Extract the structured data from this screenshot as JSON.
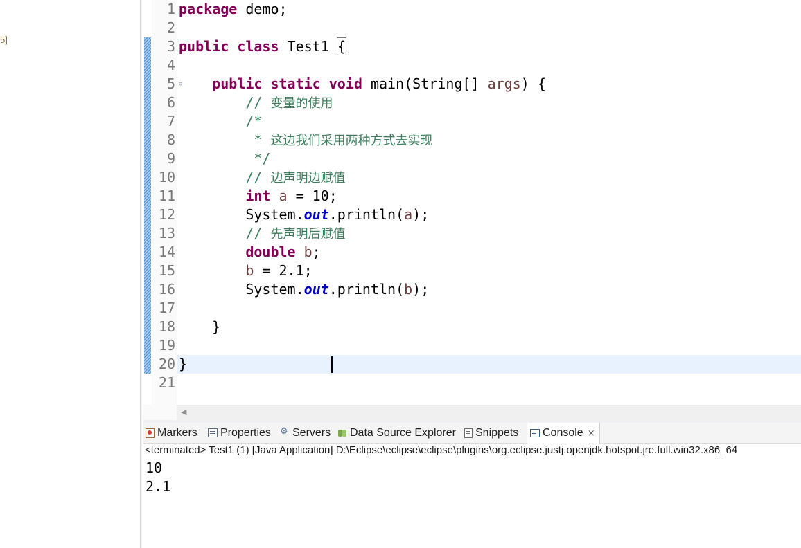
{
  "left_pane": {
    "fragment": "5]"
  },
  "editor": {
    "line_numbers": [
      "1",
      "2",
      "3",
      "4",
      "5",
      "6",
      "7",
      "8",
      "9",
      "10",
      "11",
      "12",
      "13",
      "14",
      "15",
      "16",
      "17",
      "18",
      "19",
      "20",
      "21"
    ],
    "lines": [
      [
        {
          "t": "package",
          "c": "kw"
        },
        {
          "t": " demo;"
        }
      ],
      [],
      [
        {
          "t": "public",
          "c": "kw"
        },
        {
          "t": " "
        },
        {
          "t": "class",
          "c": "kw"
        },
        {
          "t": " Test1 "
        },
        {
          "t": "{",
          "c": "brace-box"
        }
      ],
      [],
      [
        {
          "t": "    "
        },
        {
          "t": "public",
          "c": "kw"
        },
        {
          "t": " "
        },
        {
          "t": "static",
          "c": "kw"
        },
        {
          "t": " "
        },
        {
          "t": "void",
          "c": "kw"
        },
        {
          "t": " main(String[] "
        },
        {
          "t": "args",
          "c": "var"
        },
        {
          "t": ") {"
        }
      ],
      [
        {
          "t": "        "
        },
        {
          "t": "// ",
          "c": "cm"
        },
        {
          "t": "变量的使用",
          "c": "cmcn"
        }
      ],
      [
        {
          "t": "        "
        },
        {
          "t": "/*",
          "c": "cm"
        }
      ],
      [
        {
          "t": "         "
        },
        {
          "t": "* ",
          "c": "cm"
        },
        {
          "t": "这边我们采用两种方式去实现",
          "c": "cmcn"
        }
      ],
      [
        {
          "t": "         "
        },
        {
          "t": "*/",
          "c": "cm"
        }
      ],
      [
        {
          "t": "        "
        },
        {
          "t": "// ",
          "c": "cm"
        },
        {
          "t": "边声明边赋值",
          "c": "cmcn"
        }
      ],
      [
        {
          "t": "        "
        },
        {
          "t": "int",
          "c": "kw"
        },
        {
          "t": " "
        },
        {
          "t": "a",
          "c": "var"
        },
        {
          "t": " = 10;"
        }
      ],
      [
        {
          "t": "        System."
        },
        {
          "t": "out",
          "c": "fld"
        },
        {
          "t": ".println("
        },
        {
          "t": "a",
          "c": "var"
        },
        {
          "t": ");"
        }
      ],
      [
        {
          "t": "        "
        },
        {
          "t": "// ",
          "c": "cm"
        },
        {
          "t": "先声明后赋值",
          "c": "cmcn"
        }
      ],
      [
        {
          "t": "        "
        },
        {
          "t": "double",
          "c": "kw"
        },
        {
          "t": " "
        },
        {
          "t": "b",
          "c": "var"
        },
        {
          "t": ";"
        }
      ],
      [
        {
          "t": "        "
        },
        {
          "t": "b",
          "c": "var"
        },
        {
          "t": " = 2.1;"
        }
      ],
      [
        {
          "t": "        System."
        },
        {
          "t": "out",
          "c": "fld"
        },
        {
          "t": ".println("
        },
        {
          "t": "b",
          "c": "var"
        },
        {
          "t": ");"
        }
      ],
      [],
      [
        {
          "t": "    }"
        }
      ],
      [],
      [
        {
          "t": "}"
        }
      ],
      []
    ],
    "fold_marker": "⊖",
    "scroll_left_arrow": "◀"
  },
  "tabs": [
    {
      "label": "Markers",
      "icon": "markers-icon"
    },
    {
      "label": "Properties",
      "icon": "properties-icon"
    },
    {
      "label": "Servers",
      "icon": "servers-icon"
    },
    {
      "label": "Data Source Explorer",
      "icon": "data-source-explorer-icon"
    },
    {
      "label": "Snippets",
      "icon": "snippets-icon"
    },
    {
      "label": "Console",
      "icon": "console-icon",
      "active": true,
      "close": "×"
    }
  ],
  "console": {
    "header": "<terminated> Test1 (1) [Java Application] D:\\Eclipse\\eclipse\\eclipse\\plugins\\org.eclipse.justj.openjdk.hotspot.jre.full.win32.x86_64",
    "output": [
      "10",
      "2.1"
    ]
  },
  "colors": {
    "keyword": "#7f0055",
    "comment": "#3f7f5f",
    "local_variable": "#6a3e3e",
    "static_field": "#0000c0",
    "current_line": "#e8f2fe"
  }
}
